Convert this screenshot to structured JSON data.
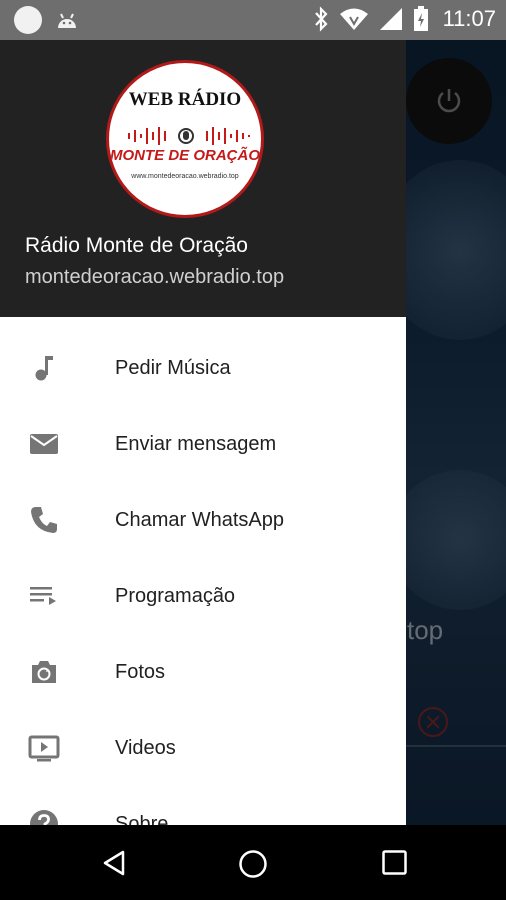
{
  "status_bar": {
    "time": "11:07",
    "icons": [
      "circle-notification-icon",
      "android-icon",
      "bluetooth-icon",
      "wifi-icon",
      "signal-icon",
      "battery-icon"
    ]
  },
  "background": {
    "domain_fragment": "top"
  },
  "drawer": {
    "header": {
      "logo_top": "WEB RÁDIO",
      "logo_mid": "MONTE DE ORAÇÃO",
      "logo_url": "www.montedeoracao.webradio.top",
      "station_name": "Rádio Monte de Oração",
      "station_url": "montedeoracao.webradio.top"
    },
    "items": [
      {
        "label": "Pedir Música",
        "icon": "music-note-icon"
      },
      {
        "label": "Enviar mensagem",
        "icon": "mail-icon"
      },
      {
        "label": "Chamar WhatsApp",
        "icon": "phone-icon"
      },
      {
        "label": "Programação",
        "icon": "playlist-icon"
      },
      {
        "label": "Fotos",
        "icon": "camera-icon"
      },
      {
        "label": "Videos",
        "icon": "video-icon"
      },
      {
        "label": "Sobre",
        "icon": "help-icon"
      }
    ]
  },
  "colors": {
    "header_bg": "#222222",
    "accent_red": "#c41a1a",
    "icon_gray": "#757575"
  },
  "nav_bar": {
    "icons": [
      "back-icon",
      "home-icon",
      "recents-icon"
    ]
  }
}
